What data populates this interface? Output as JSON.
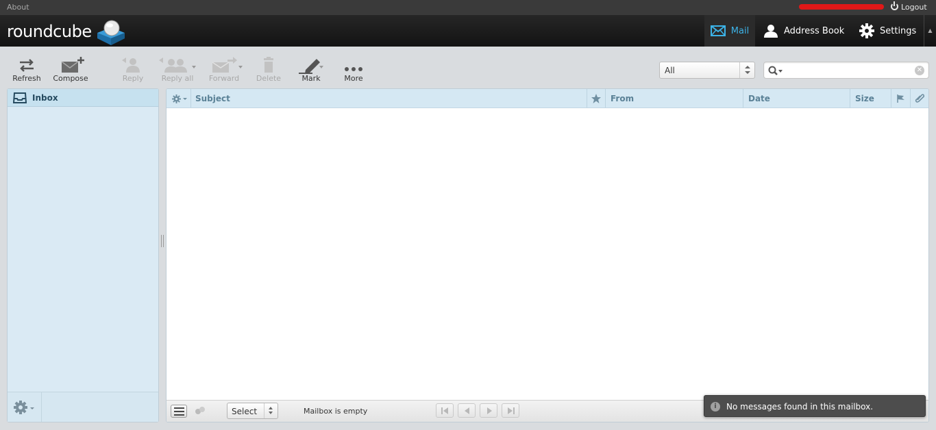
{
  "topbar": {
    "about_label": "About",
    "logout_label": "Logout"
  },
  "header": {
    "logo_text": "roundcube",
    "nav": {
      "mail": "Mail",
      "address_book": "Address Book",
      "settings": "Settings"
    },
    "accent_color": "#3cb3e8"
  },
  "toolbar": {
    "refresh": "Refresh",
    "compose": "Compose",
    "reply": "Reply",
    "reply_all": "Reply all",
    "forward": "Forward",
    "delete": "Delete",
    "mark": "Mark",
    "more": "More"
  },
  "filter": {
    "selected": "All"
  },
  "search": {
    "value": "",
    "placeholder": ""
  },
  "folders": {
    "items": [
      {
        "label": "Inbox",
        "selected": true
      }
    ]
  },
  "message_list": {
    "columns": {
      "subject": "Subject",
      "from": "From",
      "date": "Date",
      "size": "Size"
    },
    "rows": []
  },
  "footer": {
    "select_label": "Select",
    "count_text": "Mailbox is empty"
  },
  "notification": {
    "text": "No messages found in this mailbox."
  }
}
